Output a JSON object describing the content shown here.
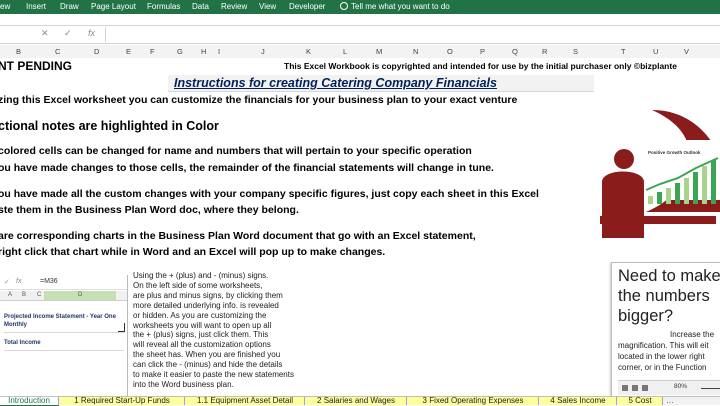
{
  "ribbon": {
    "tabs": [
      "ew",
      "Insert",
      "Draw",
      "Page Layout",
      "Formulas",
      "Data",
      "Review",
      "View",
      "Developer"
    ],
    "tell_me": "Tell me what you want to do"
  },
  "formula_bar": {
    "cancel": "✕",
    "enter": "✓",
    "fx": "fx",
    "value": ""
  },
  "column_headers": [
    "B",
    "C",
    "D",
    "E",
    "F",
    "G",
    "H",
    "I",
    "J",
    "K",
    "L",
    "M",
    "N",
    "O",
    "P",
    "Q",
    "R",
    "S",
    "T",
    "U",
    "V"
  ],
  "sheet": {
    "status": "NT PENDING",
    "copyright": "This Excel Workbook is copyrighted and intended for use by the initial purchaser only  ©bizplante",
    "instructions_title": "Instructions for creating Catering Company Financials",
    "line1": "zing this Excel worksheet you can customize the financials for your business plan to your exact venture",
    "line2": "ctional notes are highlighted in Color",
    "line3": "colored cells can be changed for name and numbers that will pertain to your specific operation",
    "line4": "ou have made changes to those cells, the remainder of the financial statements will change in tune.",
    "line5": "ou have made all the custom changes with your company specific figures, just copy each sheet in this Excel",
    "line6": "ste them in the Business Plan Word doc, where they belong.",
    "line7": "are corresponding charts in the Business Plan Word document that go with an Excel statement,",
    "line8": "right click that chart while in Word and an Excel will pop up to make changes."
  },
  "logo": {
    "caption": "Positive Growth Outlook",
    "colors": {
      "dark_red": "#8b1c1c",
      "green": "#3aa655",
      "light_green": "#a7d38a"
    }
  },
  "mini_screenshot": {
    "cell_ref": "=M36",
    "cols": [
      "A",
      "B",
      "C",
      "D"
    ],
    "row1": "Projected Income Statement - Year One",
    "row2": "Monthly",
    "row3": "Total Income"
  },
  "help_lines": [
    "Using the + (plus) and - (minus) signs.",
    "On the left side of some worksheets,",
    "are plus and minus signs, by clicking them",
    "more detailed underlying info. is revealed",
    "or hidden. As you are customizing the",
    "worksheets you will want to open up all",
    "the + (plus) signs, just click them. This",
    "will reveal all the customization options",
    "the sheet has. When you are finished you",
    "can click the - (minus) and hide the details",
    "to make it easier to paste the new statements",
    "into the Word business plan."
  ],
  "bigger_box": {
    "title_lines": [
      "Need to make",
      "the numbers",
      "bigger?"
    ],
    "body_lines": [
      "Increase the",
      "magnification. This will eit",
      "located in the lower right",
      "corner, or in the Function"
    ],
    "zoom": "80%"
  },
  "sheet_tabs": [
    {
      "label": "Introduction",
      "active": true
    },
    {
      "label": "1 Required Start-Up Funds",
      "active": false
    },
    {
      "label": "1.1 Equipment Asset Detail",
      "active": false
    },
    {
      "label": "2 Salaries and Wages",
      "active": false
    },
    {
      "label": "3 Fixed Operating Expenses",
      "active": false
    },
    {
      "label": "4 Sales Income",
      "active": false
    },
    {
      "label": "5 Cost",
      "active": false
    }
  ]
}
